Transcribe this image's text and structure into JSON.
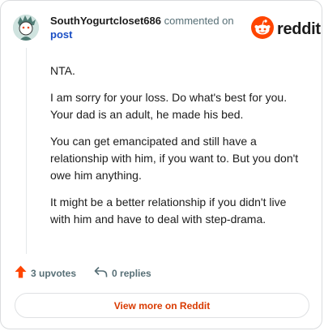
{
  "comment": {
    "username": "SouthYogurtcloset686",
    "action_text": "commented on",
    "post_link": "post",
    "paragraphs": [
      "NTA.",
      "I am sorry for your loss. Do what's best for you. Your dad is an adult, he made his bed.",
      "You can get emancipated and still have a relationship with him, if you want to. But you don't owe him anything.",
      "It might be a better relationship if you didn't live with him and have to deal with step-drama."
    ],
    "upvotes_label": "3 upvotes",
    "replies_label": "0 replies"
  },
  "brand": {
    "name": "reddit",
    "icon": "reddit-snoo-icon",
    "color": "#ff4500"
  },
  "footer": {
    "view_more_label": "View more on Reddit"
  },
  "colors": {
    "upvote": "#ff4500",
    "link": "#1a4ec4",
    "view_more": "#d93a00"
  },
  "icons": {
    "avatar": "avatar",
    "upvote": "upvote-arrow-icon",
    "reply": "reply-arrow-icon"
  }
}
